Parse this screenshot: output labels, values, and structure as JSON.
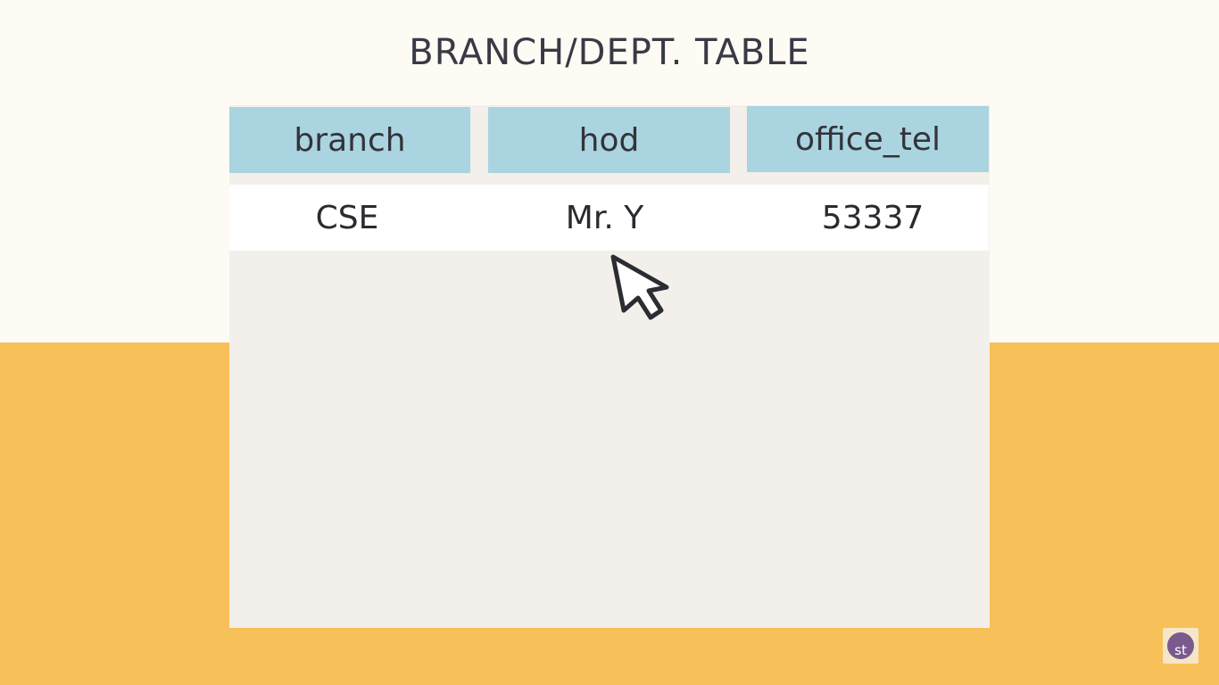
{
  "title": "BRANCH/DEPT. TABLE",
  "table": {
    "headers": [
      "branch",
      "hod",
      "office_tel"
    ],
    "rows": [
      [
        "CSE",
        "Mr. Y",
        "53337"
      ]
    ]
  },
  "logo": {
    "text": "st"
  },
  "colors": {
    "header_bg": "#aad4e0",
    "panel_bg": "#f3efea",
    "top_bg": "#fefaf4",
    "bottom_bg": "#f8c058"
  },
  "icons": {
    "cursor": "mouse-pointer-icon"
  }
}
